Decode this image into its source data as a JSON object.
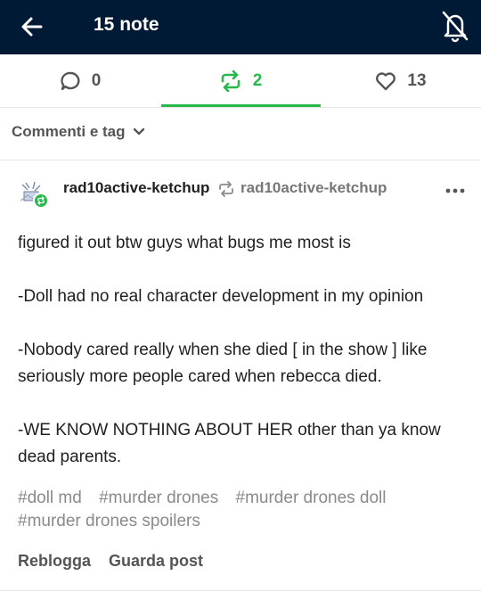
{
  "header": {
    "title": "15 note",
    "back_icon": "arrow-left-icon",
    "mute_icon": "bell-off-icon",
    "background": "#001935"
  },
  "tabs": [
    {
      "icon": "comment-icon",
      "count": "0",
      "active": false
    },
    {
      "icon": "reblog-icon",
      "count": "2",
      "active": true
    },
    {
      "icon": "heart-icon",
      "count": "13",
      "active": false
    }
  ],
  "sort": {
    "label": "Commenti e tag",
    "icon": "chevron-down-icon"
  },
  "post": {
    "author": "rad10active-ketchup",
    "source": "rad10active-ketchup",
    "paragraphs": [
      "figured it out btw guys what bugs me most is",
      "-Doll had no real character development in my opinion",
      "-Nobody cared really when she died [ in the show ] like seriously more people cared when rebecca died.",
      "-WE KNOW NOTHING ABOUT HER other than ya know dead parents."
    ],
    "tags": [
      "#doll md",
      "#murder drones",
      "#murder drones doll",
      "#murder drones spoilers"
    ]
  },
  "actions": {
    "reblog": "Reblogga",
    "view_post": "Guarda post"
  },
  "colors": {
    "accent": "#28b84c",
    "muted": "#555555",
    "tag": "#8a8a8a"
  }
}
